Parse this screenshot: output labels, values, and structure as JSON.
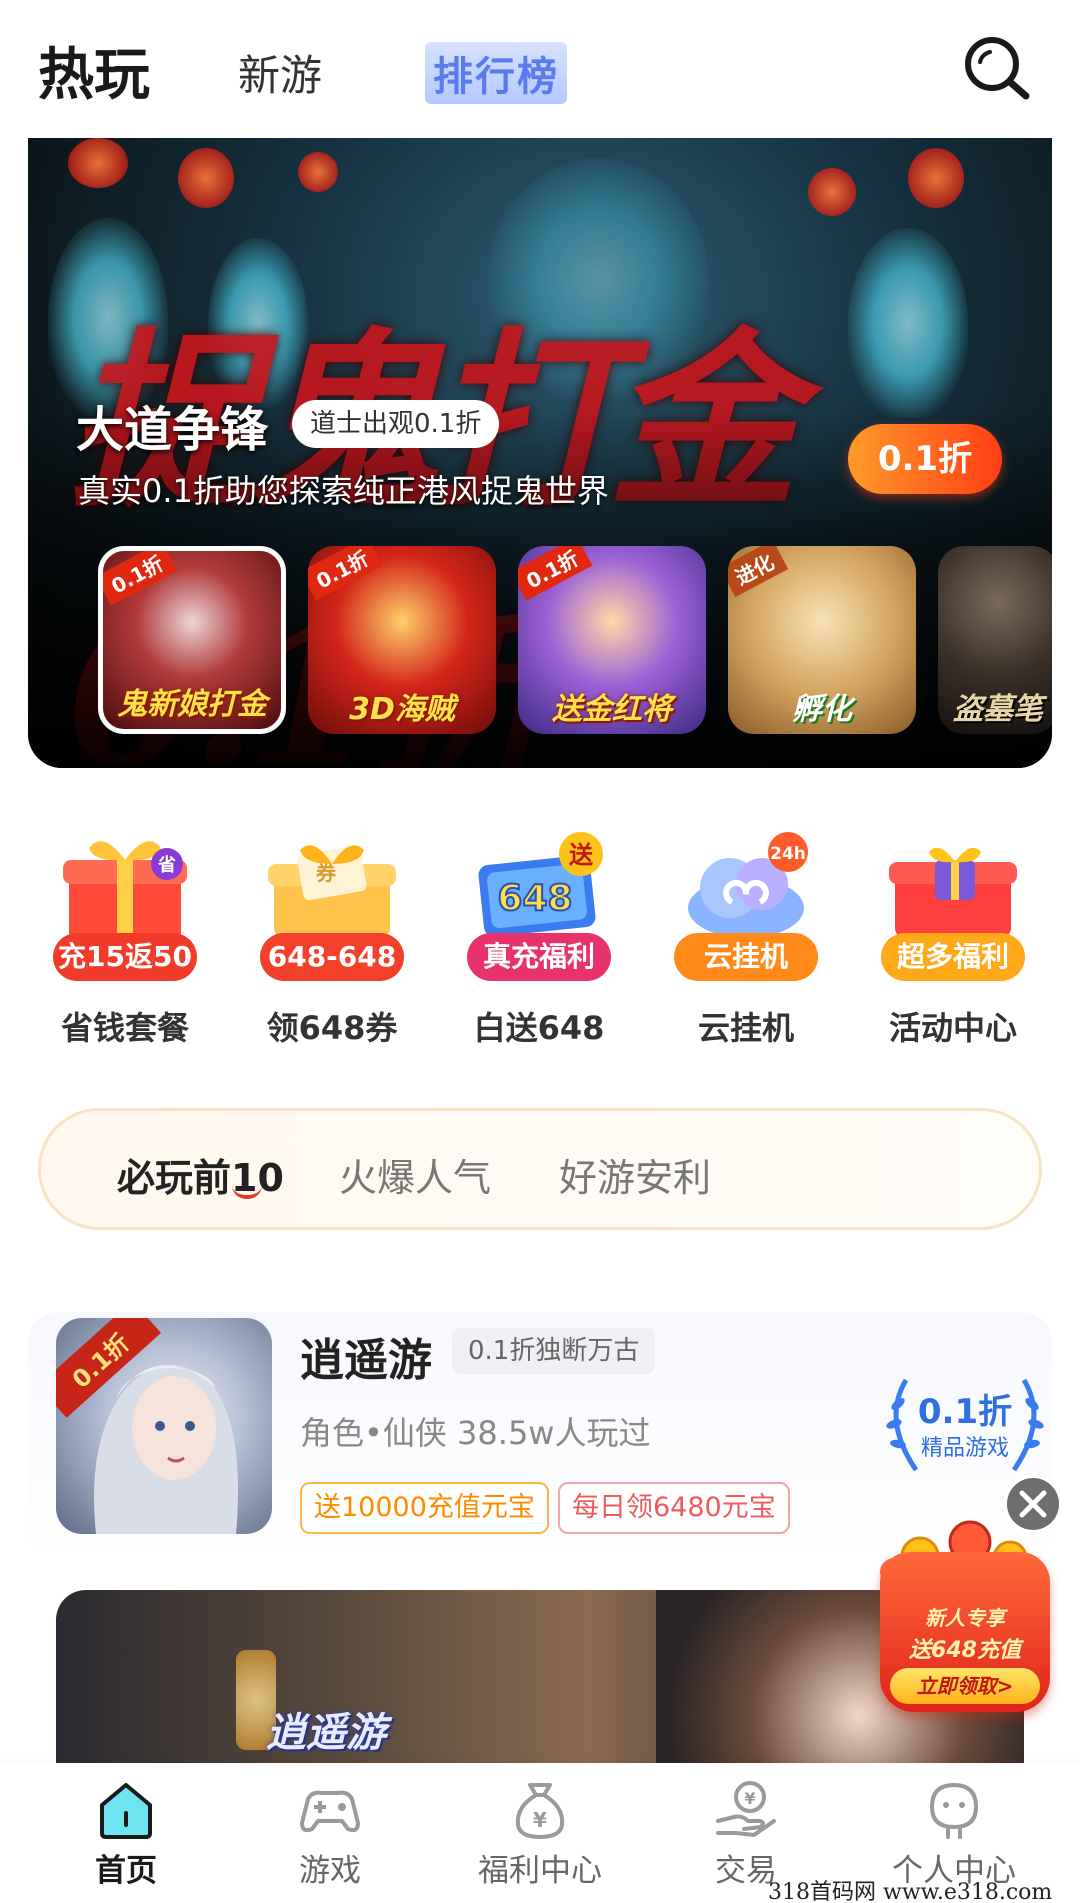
{
  "header": {
    "tabs": [
      {
        "label": "热玩",
        "active": true
      },
      {
        "label": "新游",
        "active": false
      },
      {
        "label": "排行榜",
        "active": false
      }
    ],
    "search_icon": "search-icon"
  },
  "banner": {
    "headline": "捉鬼打金0.1折",
    "title": "大道争锋",
    "tag": "道士出观0.1折",
    "description": "真实0.1折助您探索纯正港风捉鬼世界",
    "discount": "0.1折",
    "thumbnails": [
      {
        "corner": "0.1折",
        "label": "鬼新娘打金"
      },
      {
        "corner": "0.1折",
        "label": "3D海贼"
      },
      {
        "corner": "0.1折",
        "label": "送金红将"
      },
      {
        "corner": "进化",
        "label": "孵化"
      },
      {
        "corner": "",
        "label": "盗墓笔"
      }
    ]
  },
  "quick_actions": [
    {
      "pill": "充15返50",
      "label": "省钱套餐",
      "badge": "省",
      "color": "#f03a2a",
      "icon": "gift-box-icon"
    },
    {
      "pill": "648-648",
      "label": "领648券",
      "badge": "",
      "color": "#f2402a",
      "icon": "coupon-gift-icon"
    },
    {
      "pill": "真充福利",
      "label": "白送648",
      "badge": "送",
      "color": "#e8336a",
      "icon": "648-card-icon"
    },
    {
      "pill": "云挂机",
      "label": "云挂机",
      "badge": "24h",
      "color": "#ff8a1a",
      "icon": "cloud-icon"
    },
    {
      "pill": "超多福利",
      "label": "活动中心",
      "badge": "",
      "color": "#ffa81a",
      "icon": "activity-gift-icon"
    }
  ],
  "categories": [
    {
      "label": "必玩前10",
      "active": true
    },
    {
      "label": "火爆人气",
      "active": false
    },
    {
      "label": "好游安利",
      "active": false
    }
  ],
  "game_card": {
    "corner": "0.1折",
    "title": "逍遥游",
    "tag": "0.1折独断万古",
    "meta": "角色•仙侠  38.5w人玩过",
    "chips": [
      "送10000充值元宝",
      "每日领6480元宝"
    ],
    "badge_top": "0.1折",
    "badge_bottom": "精品游戏"
  },
  "second_card": {
    "logo": "逍遥游"
  },
  "promo": {
    "line1": "新人专享",
    "line2": "送648充值",
    "button": "立即领取>"
  },
  "bottom_nav": [
    {
      "label": "首页",
      "icon": "home-icon",
      "active": true
    },
    {
      "label": "游戏",
      "icon": "gamepad-icon",
      "active": false
    },
    {
      "label": "福利中心",
      "icon": "money-bag-icon",
      "active": false
    },
    {
      "label": "交易",
      "icon": "trade-hand-icon",
      "active": false
    },
    {
      "label": "个人中心",
      "icon": "profile-icon",
      "active": false
    }
  ],
  "watermark": "318首码网  www.e318.com",
  "colors": {
    "accent_blue": "#2f6fe0",
    "accent_orange": "#ff8a00",
    "discount_red": "#ff3e16"
  }
}
